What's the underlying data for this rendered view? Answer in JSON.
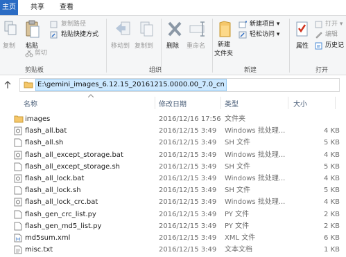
{
  "tabs": [
    "主页",
    "共享",
    "查看"
  ],
  "ribbon": {
    "copy": "复制",
    "paste": "粘贴",
    "copy_path": "复制路径",
    "paste_shortcut": "粘贴快捷方式",
    "cut": "剪切",
    "clipboard_group": "剪贴板",
    "move_to": "移动到",
    "copy_to": "复制到",
    "delete": "删除",
    "rename": "重命名",
    "organize_group": "组织",
    "new_folder": "新建\n文件夹",
    "new_folder_line1": "新建",
    "new_folder_line2": "文件夹",
    "new_item": "新建项目 ▾",
    "easy_access": "轻松访问 ▾",
    "new_group": "新建",
    "properties": "属性",
    "open": "打开 ▾",
    "edit": "编辑",
    "history": "历史记",
    "open_group": "打开"
  },
  "address": "E:\\gemini_images_6.12.15_20161215.0000.00_7.0_cn",
  "columns": {
    "name": "名称",
    "modified": "修改日期",
    "type": "类型",
    "size": "大小"
  },
  "files": [
    {
      "name": "images",
      "date": "2016/12/16 17:56",
      "type": "文件夹",
      "size": "",
      "icon": "folder-icon"
    },
    {
      "name": "flash_all.bat",
      "date": "2016/12/15 3:49",
      "type": "Windows 批处理...",
      "size": "4 KB",
      "icon": "batch-file-icon"
    },
    {
      "name": "flash_all.sh",
      "date": "2016/12/15 3:49",
      "type": "SH 文件",
      "size": "5 KB",
      "icon": "file-icon"
    },
    {
      "name": "flash_all_except_storage.bat",
      "date": "2016/12/15 3:49",
      "type": "Windows 批处理...",
      "size": "4 KB",
      "icon": "batch-file-icon"
    },
    {
      "name": "flash_all_except_storage.sh",
      "date": "2016/12/15 3:49",
      "type": "SH 文件",
      "size": "5 KB",
      "icon": "file-icon"
    },
    {
      "name": "flash_all_lock.bat",
      "date": "2016/12/15 3:49",
      "type": "Windows 批处理...",
      "size": "4 KB",
      "icon": "batch-file-icon"
    },
    {
      "name": "flash_all_lock.sh",
      "date": "2016/12/15 3:49",
      "type": "SH 文件",
      "size": "5 KB",
      "icon": "file-icon"
    },
    {
      "name": "flash_all_lock_crc.bat",
      "date": "2016/12/15 3:49",
      "type": "Windows 批处理...",
      "size": "4 KB",
      "icon": "batch-file-icon"
    },
    {
      "name": "flash_gen_crc_list.py",
      "date": "2016/12/15 3:49",
      "type": "PY 文件",
      "size": "2 KB",
      "icon": "file-icon"
    },
    {
      "name": "flash_gen_md5_list.py",
      "date": "2016/12/15 3:49",
      "type": "PY 文件",
      "size": "2 KB",
      "icon": "file-icon"
    },
    {
      "name": "md5sum.xml",
      "date": "2016/12/15 3:49",
      "type": "XML 文件",
      "size": "6 KB",
      "icon": "xml-file-icon"
    },
    {
      "name": "misc.txt",
      "date": "2016/12/15 3:49",
      "type": "文本文档",
      "size": "1 KB",
      "icon": "text-file-icon"
    }
  ]
}
